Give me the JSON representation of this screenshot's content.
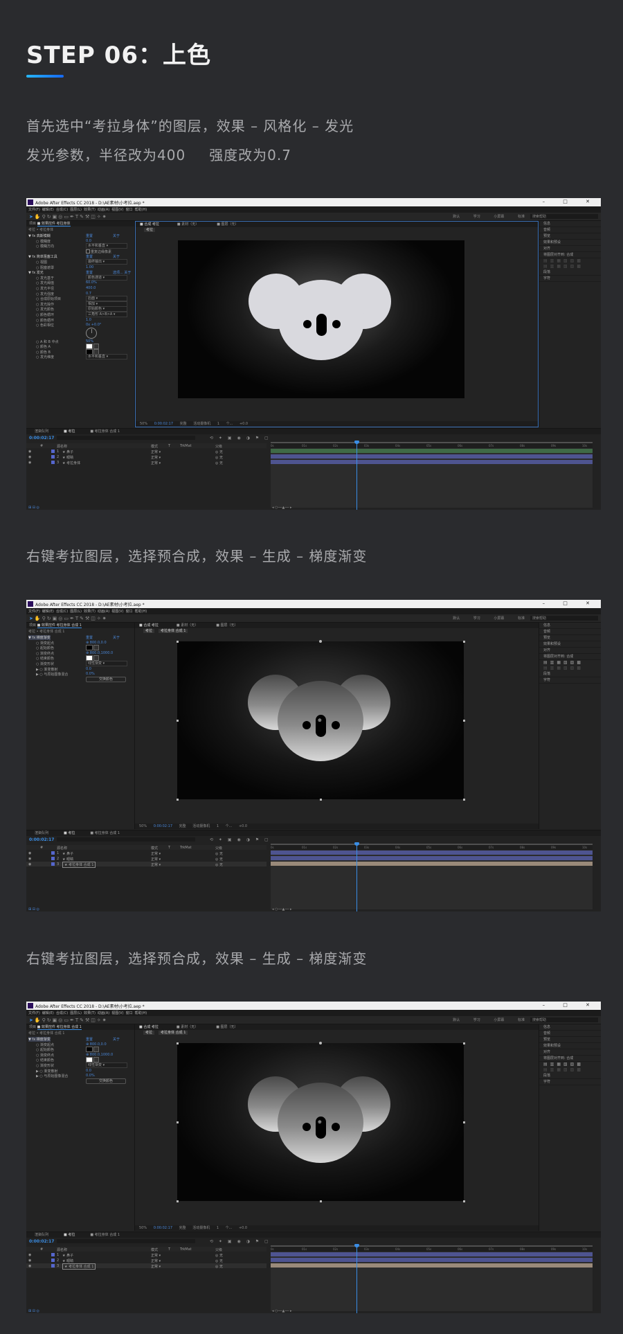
{
  "heading": {
    "title": "STEP 06：上色"
  },
  "paragraphs": {
    "p1_line1": "首先选中“考拉身体”的图层，效果 – 风格化 – 发光",
    "p1_line2_a": "发光参数，半径改为400",
    "p1_line2_b": "强度改为0.7",
    "p2": "右键考拉图层，选择预合成，效果 – 生成 – 梯度渐变",
    "p3": "右键考拉图层，选择预合成，效果 – 生成 – 梯度渐变"
  },
  "colors": {
    "accent_gradient_start": "#27b6f5",
    "accent_gradient_end": "#1668f2",
    "page_bg": "#2a2b2e"
  },
  "screenshots": [
    {
      "window_title": "Adobe After Effects CC 2018 - D:\\AE素材\\小考拉.aep *",
      "menu": [
        "文件(F)",
        "编辑(E)",
        "合成(C)",
        "图层(L)",
        "效果(T)",
        "动画(A)",
        "视图(V)",
        "窗口",
        "帮助(H)"
      ],
      "workspace": [
        "默认",
        "学习",
        "小屏幕",
        "标准"
      ],
      "search_placeholder": "搜索帮助",
      "effects_tab": "效果控件 考拉身体",
      "project_tab": "项目",
      "breadcrumb": "考拉 • 考拉身体",
      "effect_rows": [
        {
          "name": "▼ fx  高斯模糊",
          "val": "重置",
          "extra": "关于",
          "header": true
        },
        {
          "name": "○ 模糊度",
          "val": "0.0"
        },
        {
          "name": "○ 模糊方向",
          "ctl": "水平和垂直"
        },
        {
          "name": "",
          "check": true,
          "checklabel": "重复边缘像素"
        },
        {
          "name": "▼ fx  简单阻塞工具",
          "val": "重置",
          "extra": "关于",
          "header": true
        },
        {
          "name": "○ 视图",
          "ctl": "最终输出"
        },
        {
          "name": "○ 阻塞遮罩",
          "val": "1.00"
        },
        {
          "name": "▼ fx  发光",
          "val": "重置",
          "extra": "选项...   关于",
          "header": true
        },
        {
          "name": "○ 发光基于",
          "ctl": "颜色通道"
        },
        {
          "name": "○ 发光阈值",
          "val": "60.0%"
        },
        {
          "name": "○ 发光半径",
          "val": "400.0"
        },
        {
          "name": "○ 发光强度",
          "val": "0.7"
        },
        {
          "name": "○ 合成原始项目",
          "ctl": "后面"
        },
        {
          "name": "○ 发光操作",
          "ctl": "相加"
        },
        {
          "name": "○ 发光颜色",
          "ctl": "原始颜色"
        },
        {
          "name": "○ 颜色循环",
          "ctl": "三角形 A>B>A"
        },
        {
          "name": "○ 颜色循环",
          "val": "1.0"
        },
        {
          "name": "○ 色彩相位",
          "val": "0x +0.0°"
        },
        {
          "name": "",
          "dial": true
        },
        {
          "name": "○ A 和 B 中点",
          "val": "50%"
        },
        {
          "name": "○ 颜色 A",
          "swatch": "#ffffff"
        },
        {
          "name": "○ 颜色 B",
          "swatch": "#000000"
        },
        {
          "name": "○ 发光维度",
          "ctl": "水平和垂直"
        }
      ],
      "comp_tabs": [
        "合成 考拉",
        "素材（无）",
        "图层（无）"
      ],
      "comp_subtabs": [
        "考拉"
      ],
      "viewer_bottom": [
        "50%",
        "0:00:02:17",
        "完整",
        "活动摄像机",
        "1 个...",
        "+0.0"
      ],
      "canvas_style": "glow",
      "koala_fill": "#d9d9de",
      "show_handles": false,
      "right_panel": [
        "信息",
        "音频",
        "预览",
        "效果和预设",
        "对齐",
        "段落",
        "字符"
      ],
      "align_label": "将图层对齐到:",
      "align_value": "合成",
      "align_active": false,
      "timeline_tabs": [
        "渲染队列",
        "考拉",
        "考拉身体 合成 1"
      ],
      "timecode": "0:00:02:17",
      "layer_header": [
        "#",
        "源名称",
        "模式",
        "T",
        "TrkMat",
        "父级"
      ],
      "layers": [
        {
          "num": "1",
          "name": "鼻子",
          "mode": "正常",
          "parent": "无"
        },
        {
          "num": "2",
          "name": "眼睛",
          "mode": "正常",
          "parent": "无"
        },
        {
          "num": "3",
          "name": "考拉身体",
          "mode": "正常",
          "parent": "无"
        }
      ],
      "ruler_ticks": [
        "0s",
        "01s",
        "02s",
        "03s",
        "04s",
        "05s",
        "06s",
        "07s",
        "08s",
        "09s",
        "10s"
      ],
      "track_colors": [
        "#3f6a46",
        "#4e5490",
        "#4e5490"
      ]
    },
    {
      "window_title": "Adobe After Effects CC 2018 - D:\\AE素材\\小考拉.aep *",
      "menu": [
        "文件(F)",
        "编辑(E)",
        "合成(C)",
        "图层(L)",
        "效果(T)",
        "动画(A)",
        "视图(V)",
        "窗口",
        "帮助(H)"
      ],
      "workspace": [
        "默认",
        "学习",
        "小屏幕",
        "标准"
      ],
      "search_placeholder": "搜索帮助",
      "effects_tab": "效果控件 考拉身体 合成 1",
      "project_tab": "项目",
      "breadcrumb": "考拉 • 考拉身体 合成 1",
      "effect_rows": [
        {
          "name": "▼ fx  梯度渐变",
          "val": "重置",
          "extra": "关于",
          "header": true,
          "hl": true
        },
        {
          "name": "○ 渐变起点",
          "val": "800.0,0.0",
          "target": true
        },
        {
          "name": "○ 起始颜色",
          "swatch": "#000000"
        },
        {
          "name": "○ 渐变终点",
          "val": "800.0,1000.0",
          "target": true
        },
        {
          "name": "○ 结束颜色",
          "swatch": "#ffffff"
        },
        {
          "name": "○ 渐变形状",
          "ctl": "线性渐变"
        },
        {
          "name": "▶ ○ 渐变散射",
          "val": "0.0"
        },
        {
          "name": "▶ ○ 与原始图像混合",
          "val": "0.0%"
        },
        {
          "name": "",
          "button": "交换颜色"
        }
      ],
      "comp_tabs": [
        "合成 考拉",
        "素材（无）",
        "图层（无）"
      ],
      "comp_subtabs": [
        "考拉",
        "考拉身体 合成 1"
      ],
      "viewer_bottom": [
        "50%",
        "0:00:02:17",
        "完整",
        "活动摄像机",
        "1 个...",
        "+0.0"
      ],
      "canvas_style": "grad",
      "koala_fill": "gradient",
      "show_handles": true,
      "right_panel": [
        "信息",
        "音频",
        "预览",
        "效果和预设",
        "对齐",
        "段落",
        "字符"
      ],
      "align_label": "将图层对齐到:",
      "align_value": "合成",
      "align_active": true,
      "timeline_tabs": [
        "渲染队列",
        "考拉",
        "考拉身体 合成 1"
      ],
      "timecode": "0:00:02:17",
      "layer_header": [
        "#",
        "源名称",
        "模式",
        "T",
        "TrkMat",
        "父级"
      ],
      "layers": [
        {
          "num": "1",
          "name": "鼻子",
          "mode": "正常",
          "parent": "无"
        },
        {
          "num": "2",
          "name": "眼睛",
          "mode": "正常",
          "parent": "无"
        },
        {
          "num": "3",
          "name": "考拉身体 合成 1",
          "mode": "正常",
          "parent": "无",
          "boxed": true
        }
      ],
      "ruler_ticks": [
        "0s",
        "01s",
        "02s",
        "03s",
        "04s",
        "05s",
        "06s",
        "07s",
        "08s",
        "09s",
        "10s"
      ],
      "track_colors": [
        "#4e5490",
        "#4e5490",
        "#9a8a7a"
      ]
    },
    {
      "window_title": "Adobe After Effects CC 2018 - D:\\AE素材\\小考拉.aep *",
      "menu": [
        "文件(F)",
        "编辑(E)",
        "合成(C)",
        "图层(L)",
        "效果(T)",
        "动画(A)",
        "视图(V)",
        "窗口",
        "帮助(H)"
      ],
      "workspace": [
        "默认",
        "学习",
        "小屏幕",
        "标准"
      ],
      "search_placeholder": "搜索帮助",
      "effects_tab": "效果控件 考拉身体 合成 1",
      "project_tab": "项目",
      "breadcrumb": "考拉 • 考拉身体 合成 1",
      "effect_rows": [
        {
          "name": "▼ fx  梯度渐变",
          "val": "重置",
          "extra": "关于",
          "header": true,
          "hl": true
        },
        {
          "name": "○ 渐变起点",
          "val": "800.0,0.0",
          "target": true
        },
        {
          "name": "○ 起始颜色",
          "swatch": "#000000"
        },
        {
          "name": "○ 渐变终点",
          "val": "800.0,1000.0",
          "target": true
        },
        {
          "name": "○ 结束颜色",
          "swatch": "#ffffff"
        },
        {
          "name": "○ 渐变形状",
          "ctl": "线性渐变"
        },
        {
          "name": "▶ ○ 渐变散射",
          "val": "0.0"
        },
        {
          "name": "▶ ○ 与原始图像混合",
          "val": "0.0%"
        },
        {
          "name": "",
          "button": "交换颜色"
        }
      ],
      "comp_tabs": [
        "合成 考拉",
        "素材（无）",
        "图层（无）"
      ],
      "comp_subtabs": [
        "考拉",
        "考拉身体 合成 1"
      ],
      "viewer_bottom": [
        "50%",
        "0:00:02:17",
        "完整",
        "活动摄像机",
        "1 个...",
        "+0.0"
      ],
      "canvas_style": "grad",
      "koala_fill": "gradient",
      "show_handles": true,
      "right_panel": [
        "信息",
        "音频",
        "预览",
        "效果和预设",
        "对齐",
        "段落",
        "字符"
      ],
      "align_label": "将图层对齐到:",
      "align_value": "合成",
      "align_active": true,
      "timeline_tabs": [
        "渲染队列",
        "考拉",
        "考拉身体 合成 1"
      ],
      "timecode": "0:00:02:17",
      "layer_header": [
        "#",
        "源名称",
        "模式",
        "T",
        "TrkMat",
        "父级"
      ],
      "layers": [
        {
          "num": "1",
          "name": "鼻子",
          "mode": "正常",
          "parent": "无"
        },
        {
          "num": "2",
          "name": "眼睛",
          "mode": "正常",
          "parent": "无"
        },
        {
          "num": "3",
          "name": "考拉身体 合成 1",
          "mode": "正常",
          "parent": "无",
          "boxed": true
        }
      ],
      "ruler_ticks": [
        "0s",
        "01s",
        "02s",
        "03s",
        "04s",
        "05s",
        "06s",
        "07s",
        "08s",
        "09s",
        "10s"
      ],
      "track_colors": [
        "#4e5490",
        "#4e5490",
        "#9a8a7a"
      ]
    }
  ]
}
